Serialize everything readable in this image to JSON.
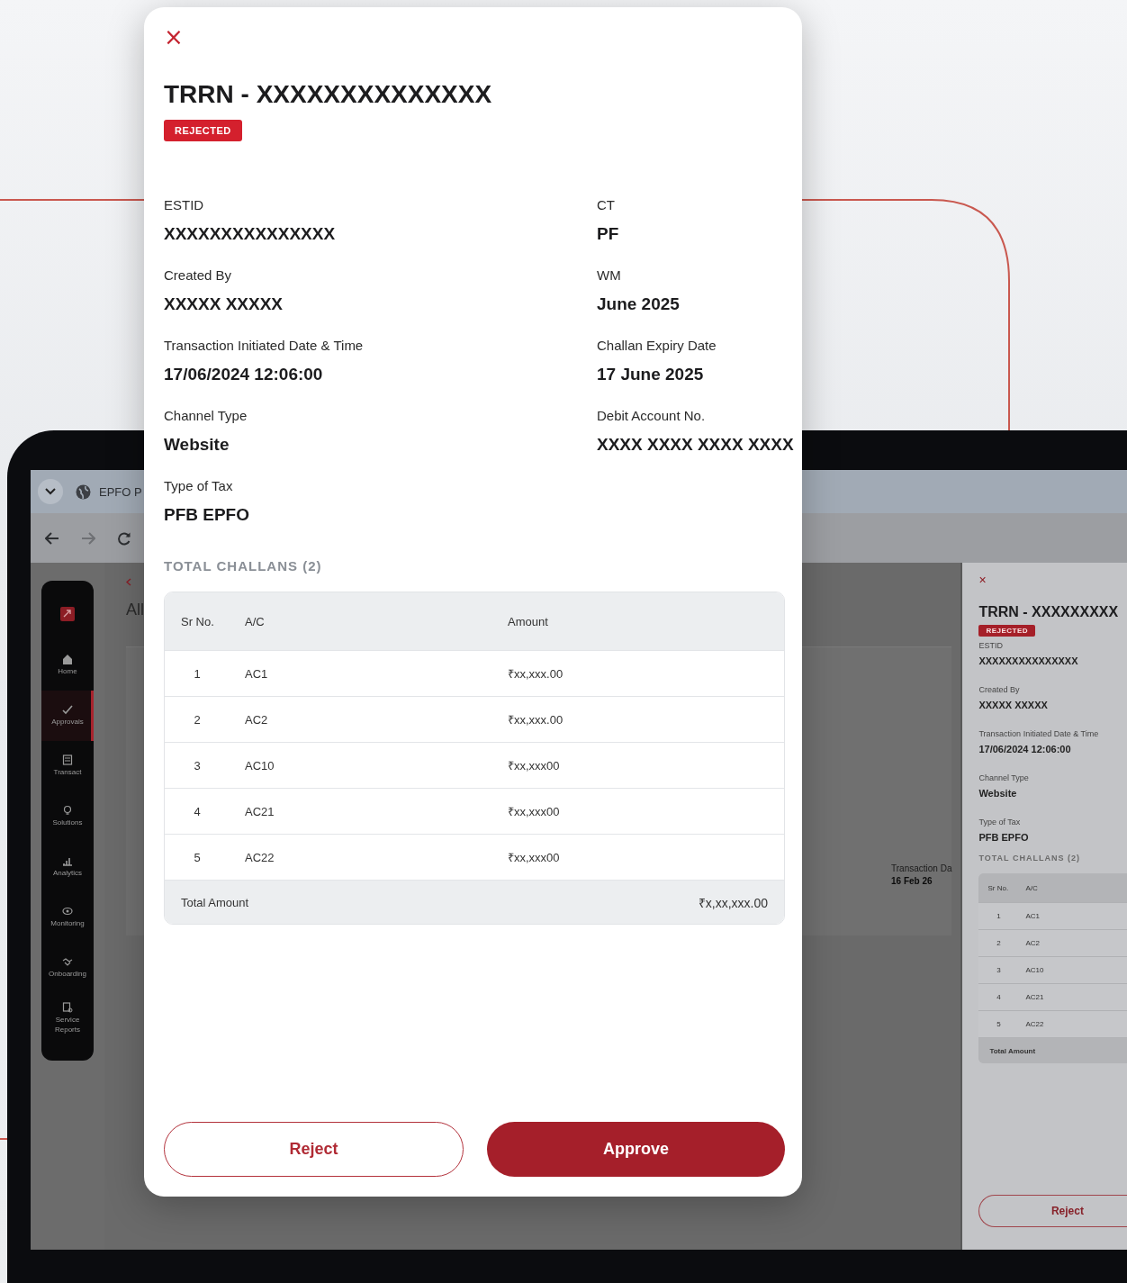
{
  "modal": {
    "close": "×",
    "title": "TRRN - XXXXXXXXXXXXXX",
    "status": "REJECTED",
    "fields": [
      {
        "label": "ESTID",
        "value": "XXXXXXXXXXXXXXX"
      },
      {
        "label": "CT",
        "value": "PF"
      },
      {
        "label": "Created By",
        "value": "XXXXX XXXXX"
      },
      {
        "label": "WM",
        "value": "June 2025"
      },
      {
        "label": "Transaction Initiated Date & Time",
        "value": "17/06/2024 12:06:00"
      },
      {
        "label": "Challan Expiry Date",
        "value": "17 June 2025"
      },
      {
        "label": "Channel Type",
        "value": "Website"
      },
      {
        "label": "Debit Account No.",
        "value": "XXXX XXXX XXXX XXXX"
      },
      {
        "label": "Type of Tax",
        "value": "PFB EPFO"
      }
    ],
    "challans_heading": "TOTAL CHALLANS (2)",
    "table": {
      "columns": [
        "Sr No.",
        "A/C",
        "Amount"
      ],
      "rows": [
        [
          "1",
          "AC1",
          "₹xx,xxx.00"
        ],
        [
          "2",
          "AC2",
          "₹xx,xxx.00"
        ],
        [
          "3",
          "AC10",
          "₹xx,xxx00"
        ],
        [
          "4",
          "AC21",
          "₹xx,xxx00"
        ],
        [
          "5",
          "AC22",
          "₹xx,xxx00"
        ]
      ],
      "total_label": "Total Amount",
      "total_value": "₹x,xx,xxx.00"
    },
    "buttons": [
      {
        "label": "Reject",
        "kind": "secondary"
      },
      {
        "label": "Approve",
        "kind": "primary"
      }
    ]
  },
  "laptop": {
    "browser_tab": "EPFO P",
    "sidebar": {
      "items": [
        {
          "label": "Home",
          "selected": false
        },
        {
          "label": "Approvals",
          "selected": true
        },
        {
          "label": "Transact",
          "selected": false
        },
        {
          "label": "Solutions",
          "selected": false
        },
        {
          "label": "Analytics",
          "selected": false
        },
        {
          "label": "Monitoring",
          "selected": false
        },
        {
          "label": "Onboarding",
          "selected": false
        },
        {
          "label": "Service Reports",
          "selected": false
        }
      ]
    },
    "page_title": "All",
    "transaction": {
      "label": "Transaction Da",
      "value": "16 Feb 26"
    },
    "side_panel": {
      "close": "×",
      "title": "TRRN - XXXXXXXXX",
      "status": "REJECTED",
      "fields": [
        {
          "label": "ESTID",
          "value": "XXXXXXXXXXXXXXX"
        },
        {
          "label": "Created By",
          "value": "XXXXX XXXXX"
        },
        {
          "label": "Transaction Initiated Date & Time",
          "value": "17/06/2024 12:06:00"
        },
        {
          "label": "Channel Type",
          "value": "Website"
        },
        {
          "label": "Type of Tax",
          "value": "PFB EPFO"
        }
      ],
      "challans_heading": "TOTAL CHALLANS (2)",
      "table": {
        "columns": [
          "Sr No.",
          "A/C"
        ],
        "rows": [
          [
            "1",
            "AC1"
          ],
          [
            "2",
            "AC2"
          ],
          [
            "3",
            "AC10"
          ],
          [
            "4",
            "AC21"
          ],
          [
            "5",
            "AC22"
          ]
        ],
        "total_label": "Total Amount"
      },
      "button": "Reject"
    }
  }
}
